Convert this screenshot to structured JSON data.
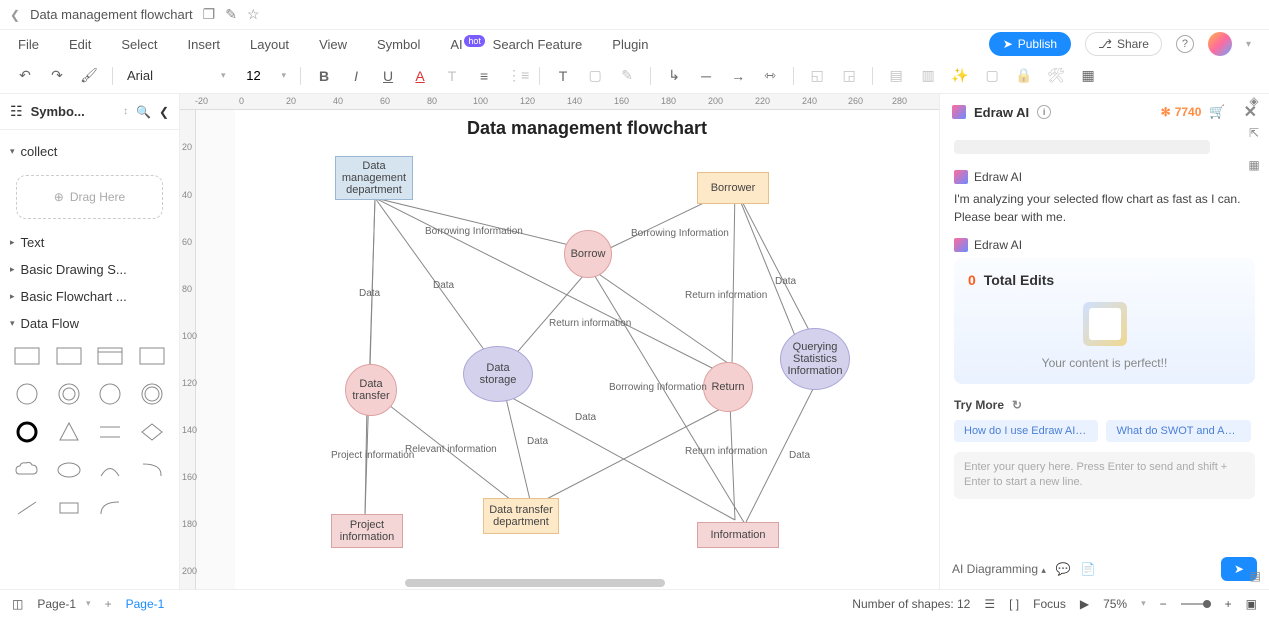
{
  "header": {
    "docTitle": "Data management flowchart"
  },
  "menu": {
    "items": [
      "File",
      "Edit",
      "Select",
      "Insert",
      "Layout",
      "View",
      "Symbol",
      "AI",
      "Search Feature",
      "Plugin"
    ],
    "hotBadge": "hot",
    "publish": "Publish",
    "share": "Share"
  },
  "toolbar": {
    "font": "Arial",
    "fontSize": "12"
  },
  "sidebar": {
    "title": "Symbo...",
    "collect": "collect",
    "dragHere": "Drag Here",
    "categories": [
      "Text",
      "Basic Drawing S...",
      "Basic Flowchart ...",
      "Data Flow"
    ]
  },
  "ruler": {
    "h": [
      "-20",
      "0",
      "20",
      "40",
      "60",
      "80",
      "100",
      "120",
      "140",
      "160",
      "180",
      "200",
      "220",
      "240",
      "260",
      "280"
    ],
    "v": [
      "20",
      "40",
      "60",
      "80",
      "100",
      "120",
      "140",
      "160",
      "180",
      "200"
    ]
  },
  "flowchart": {
    "title": "Data management flowchart",
    "nodes": {
      "dmd": "Data management department",
      "borrower": "Borrower",
      "borrow": "Borrow",
      "dataTransfer": "Data transfer",
      "dataStorage": "Data storage",
      "return": "Return",
      "qsi": "Querying Statistics Information",
      "projectInfo": "Project information",
      "dtd": "Data transfer department",
      "information": "Information"
    },
    "labels": {
      "bi1": "Borrowing Information",
      "bi2": "Borrowing Information",
      "bi3": "Borrowing Information",
      "data1": "Data",
      "data2": "Data",
      "data3": "Data",
      "data4": "Data",
      "data5": "Data",
      "data6": "Data",
      "ri1": "Return information",
      "ri2": "Return information",
      "ri3": "Return information",
      "pi": "Project information",
      "relevant": "Relevant information"
    }
  },
  "ai": {
    "title": "Edraw AI",
    "credits": "7740",
    "agent": "Edraw AI",
    "analyzing": "I'm analyzing your selected flow chart as fast as I can. Please bear with me.",
    "totalEdits": "Total Edits",
    "editsCount": "0",
    "perfect": "Your content is perfect!!",
    "tryMore": "Try More",
    "chip1": "How do I use Edraw AI fo...",
    "chip2": "What do SWOT and AAR...",
    "placeholder": "Enter your query here. Press Enter to send and shift + Enter to start a new line.",
    "mode": "AI Diagramming"
  },
  "statusbar": {
    "pageLeft": "Page-1",
    "pageTab": "Page-1",
    "shapes": "Number of shapes: 12",
    "focus": "Focus",
    "zoom": "75%"
  }
}
